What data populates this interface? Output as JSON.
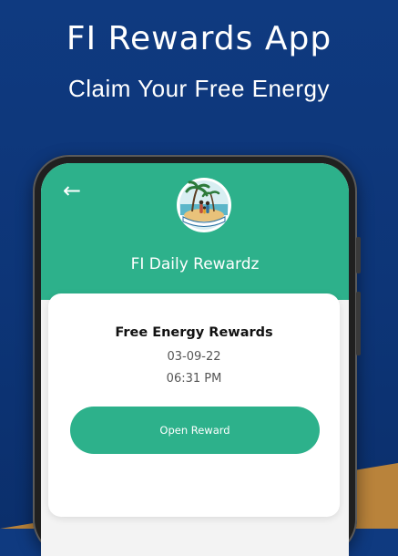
{
  "banner": {
    "headline": "FI Rewards App",
    "subheadline": "Claim Your Free Energy"
  },
  "app": {
    "back_icon": "arrow-left-icon",
    "logo": "island-family-logo",
    "title": "FI Daily Rewardz"
  },
  "card": {
    "title": "Free Energy Rewards",
    "date": "03-09-22",
    "time": "06:31 PM",
    "button_label": "Open Reward"
  },
  "colors": {
    "background": "#0f3a80",
    "accent": "#2db18b",
    "sand": "#b9833b",
    "card": "#ffffff"
  }
}
